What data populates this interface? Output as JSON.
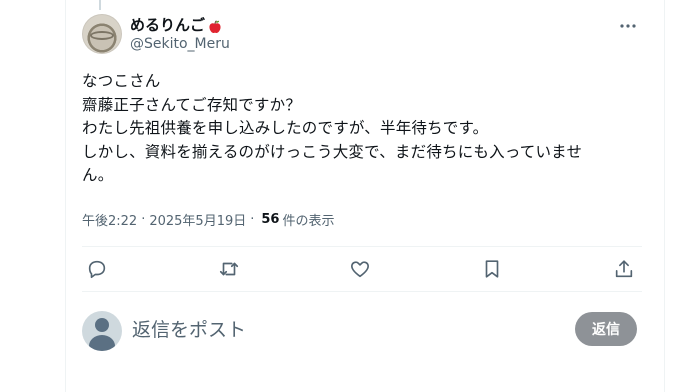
{
  "author": {
    "display_name": "めるりんご",
    "handle": "@Sekito_Meru",
    "emoji_icon": "apple-icon"
  },
  "tweet": {
    "text": "なつこさん\n齋藤正子さんてご存知ですか？\nわたし先祖供養を申し込みしたのですが、半年待ちです。\nしかし、資料を揃えるのがけっこう大変で、まだ待ちにも入っていませ\nん。",
    "time": "午後2:22",
    "separator": "·",
    "date": "2025年5月19日",
    "views_count": "56",
    "views_label": "件の表示"
  },
  "actions": [
    "reply-icon",
    "retweet-icon",
    "like-icon",
    "bookmark-icon",
    "share-icon"
  ],
  "reply_box": {
    "placeholder": "返信をポスト",
    "button_label": "返信"
  },
  "colors": {
    "text": "#0f1419",
    "secondary": "#536471",
    "divider": "#eff3f4",
    "button_disabled": "#8e9297"
  }
}
